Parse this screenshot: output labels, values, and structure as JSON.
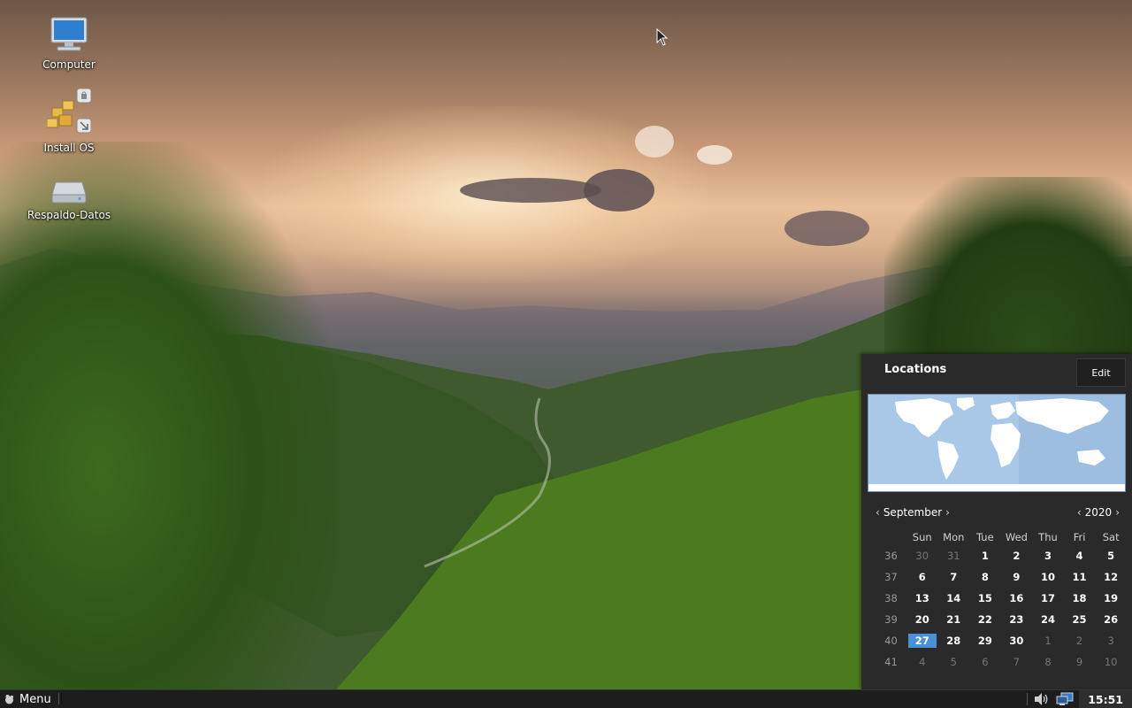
{
  "desktop": {
    "icons": [
      {
        "label": "Computer",
        "icon": "computer-icon"
      },
      {
        "label": "Install OS",
        "icon": "install-package-icon"
      },
      {
        "label": "Respaldo-Datos",
        "icon": "hard-drive-icon"
      }
    ]
  },
  "calendar_popup": {
    "locations_title": "Locations",
    "edit_label": "Edit",
    "month": "September",
    "year": "2020",
    "weekdays": [
      "Sun",
      "Mon",
      "Tue",
      "Wed",
      "Thu",
      "Fri",
      "Sat"
    ],
    "today": "27",
    "weeks": [
      {
        "week": "36",
        "days": [
          "30",
          "31",
          "1",
          "2",
          "3",
          "4",
          "5"
        ],
        "other": [
          true,
          true,
          false,
          false,
          false,
          false,
          false
        ]
      },
      {
        "week": "37",
        "days": [
          "6",
          "7",
          "8",
          "9",
          "10",
          "11",
          "12"
        ],
        "other": [
          false,
          false,
          false,
          false,
          false,
          false,
          false
        ]
      },
      {
        "week": "38",
        "days": [
          "13",
          "14",
          "15",
          "16",
          "17",
          "18",
          "19"
        ],
        "other": [
          false,
          false,
          false,
          false,
          false,
          false,
          false
        ]
      },
      {
        "week": "39",
        "days": [
          "20",
          "21",
          "22",
          "23",
          "24",
          "25",
          "26"
        ],
        "other": [
          false,
          false,
          false,
          false,
          false,
          false,
          false
        ]
      },
      {
        "week": "40",
        "days": [
          "27",
          "28",
          "29",
          "30",
          "1",
          "2",
          "3"
        ],
        "other": [
          false,
          false,
          false,
          false,
          true,
          true,
          true
        ]
      },
      {
        "week": "41",
        "days": [
          "4",
          "5",
          "6",
          "7",
          "8",
          "9",
          "10"
        ],
        "other": [
          true,
          true,
          true,
          true,
          true,
          true,
          true
        ]
      }
    ],
    "colors": {
      "background": "#2a2a2a",
      "today_highlight": "#4a90d9",
      "map_water": "#a9c8e8",
      "map_land": "#ffffff"
    }
  },
  "taskbar": {
    "menu_label": "Menu",
    "clock": "15:51",
    "tray_icons": [
      "volume-icon",
      "network-icon"
    ]
  }
}
